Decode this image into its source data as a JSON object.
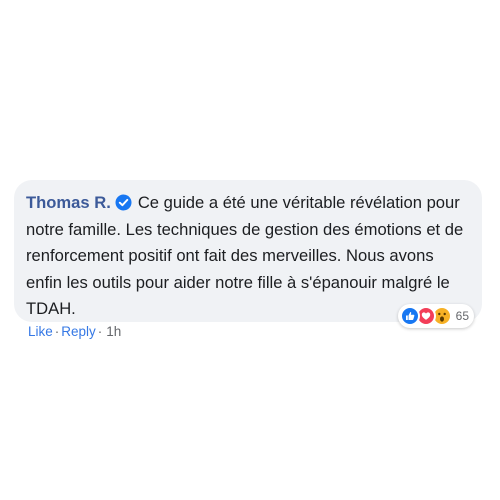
{
  "comment": {
    "author": "Thomas R.",
    "text": "Ce guide a été une véritable révélation pour notre famille. Les techniques de gestion des émotions et de renforcement positif ont fait des merveilles. Nous avons enfin les outils pour aider notre fille à s'épanouir malgré le TDAH.",
    "reactions": {
      "icons": [
        "like-icon",
        "love-icon",
        "wow-icon"
      ],
      "count": "65"
    }
  },
  "actions": {
    "like_label": "Like",
    "separator": "·",
    "reply_label": "Reply",
    "time": "1h"
  },
  "colors": {
    "author": "#3c5a99",
    "bubble_bg": "#f0f2f5",
    "link": "#3578e5",
    "verified": "#1877f2",
    "like": "#1877f2",
    "love": "#f33e58",
    "wow": "#f7b125"
  }
}
